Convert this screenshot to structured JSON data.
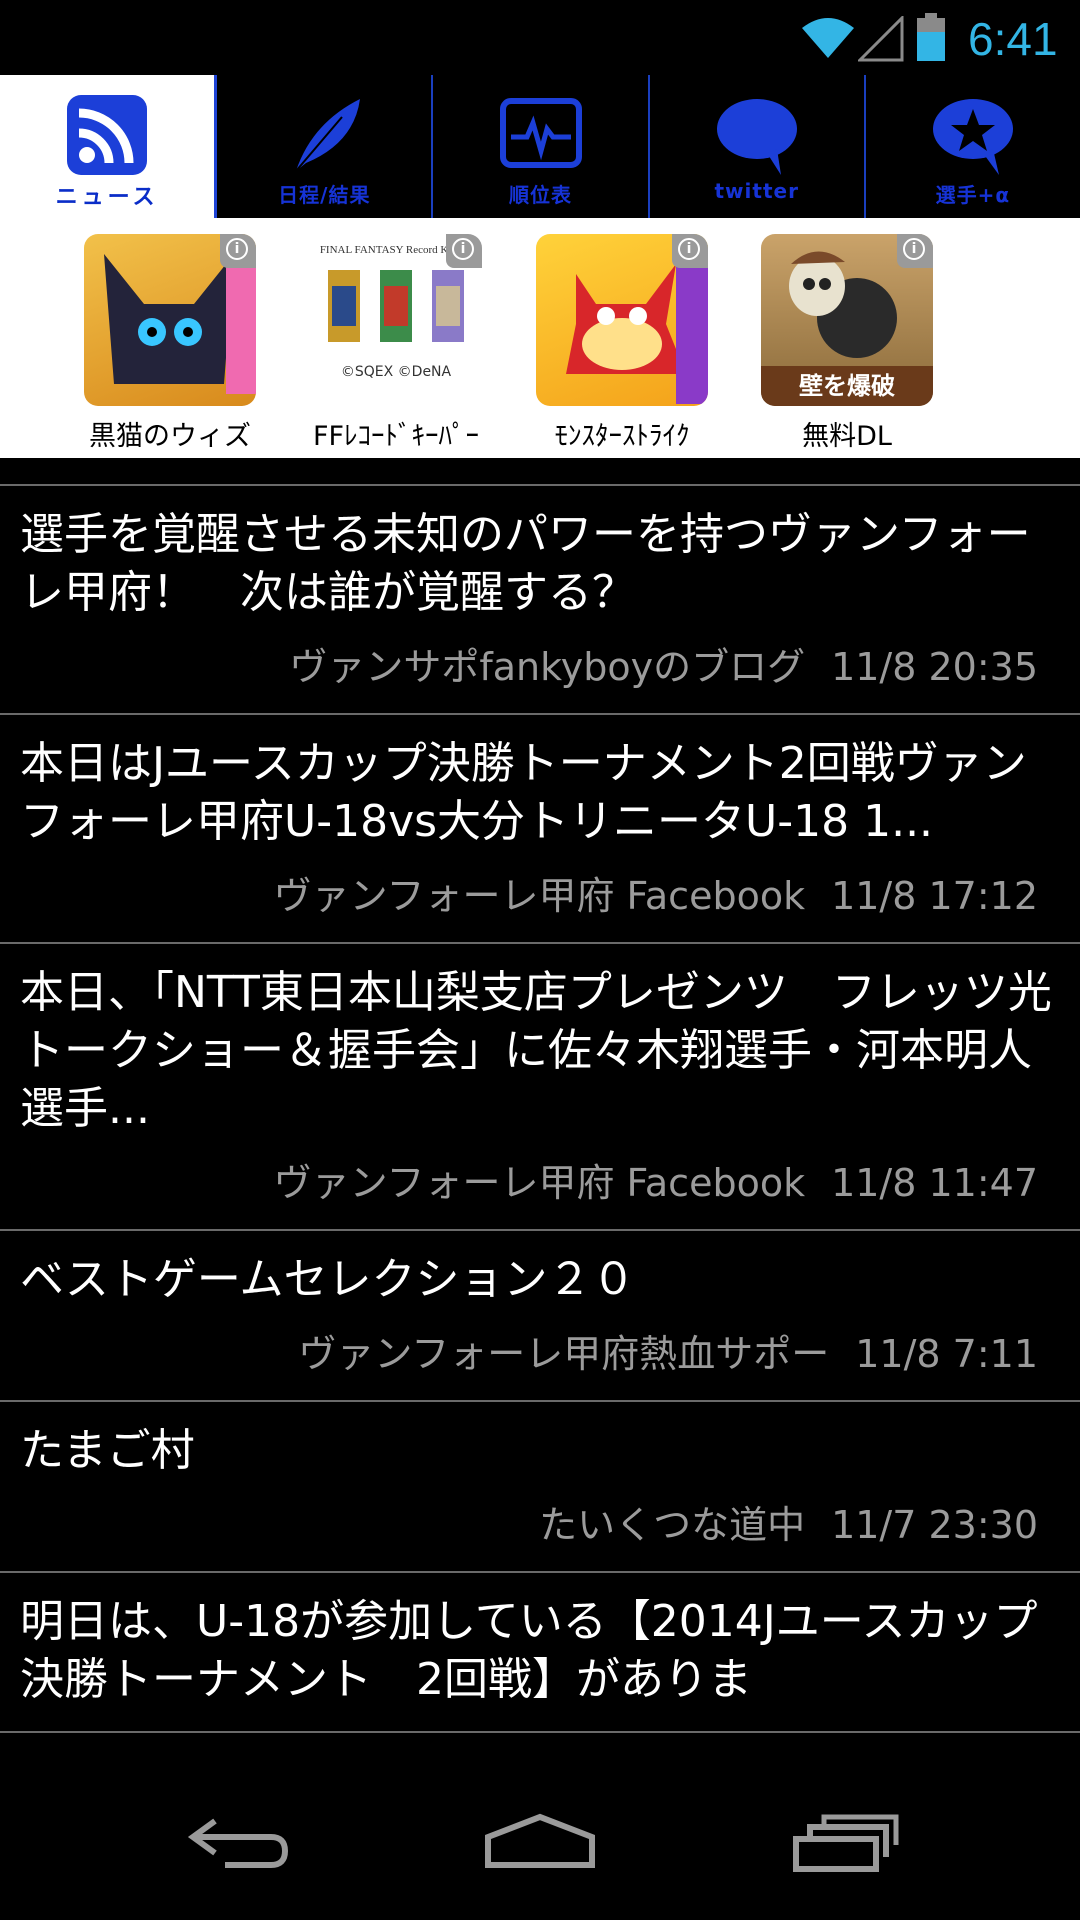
{
  "status_bar": {
    "time": "6:41",
    "icons": [
      "wifi-icon",
      "signal-icon",
      "battery-icon"
    ],
    "accent_color": "#33b5e5"
  },
  "tabs": [
    {
      "label": "ニュース",
      "icon": "rss-icon",
      "active": true
    },
    {
      "label": "日程/結果",
      "icon": "feather-icon",
      "active": false
    },
    {
      "label": "順位表",
      "icon": "pulse-monitor-icon",
      "active": false
    },
    {
      "label": "twitter",
      "icon": "speech-bubble-icon",
      "active": false
    },
    {
      "label": "選手+α",
      "icon": "star-bubble-icon",
      "active": false
    }
  ],
  "ads": [
    {
      "caption": "黒猫のウィズ",
      "icon": "black-cat-game-icon"
    },
    {
      "caption": "FFﾚｺｰﾄﾞｷｰﾊﾟｰ",
      "icon": "ff-record-keeper-icon",
      "logo_text": "FINAL FANTASY Record Keeper",
      "copyright": "©SQEX ©DeNA"
    },
    {
      "caption": "ﾓﾝｽﾀｰｽﾄﾗｲｸ",
      "icon": "monster-strike-icon"
    },
    {
      "caption": "無料DL",
      "icon": "bomb-skeleton-icon",
      "banner_text": "壁を爆破"
    }
  ],
  "feed": [
    {
      "title": "選手を覚醒させる未知のパワーを持つヴァンフォーレ甲府！　次は誰が覚醒する？",
      "source": "ヴァンサポfankyboyのブログ",
      "time": "11/8 20:35"
    },
    {
      "title": "本日はJユースカップ決勝トーナメント2回戦ヴァンフォーレ甲府U-18vs大分トリニータU-18 1...",
      "source": "ヴァンフォーレ甲府 Facebook",
      "time": "11/8 17:12"
    },
    {
      "title": "本日、「NTT東日本山梨支店プレゼンツ　フレッツ光トークショー＆握手会」に佐々木翔選手・河本明人選手...",
      "source": "ヴァンフォーレ甲府 Facebook",
      "time": "11/8 11:47"
    },
    {
      "title": "ベストゲームセレクション２０",
      "source": "ヴァンフォーレ甲府熱血サポー",
      "time": "11/8 7:11"
    },
    {
      "title": "たまご村",
      "source": "たいくつな道中",
      "time": "11/7 23:30"
    },
    {
      "title": "明日は、U-18が参加している【2014Jユースカップ 決勝トーナメント　2回戦】がありま",
      "source": "",
      "time": ""
    }
  ],
  "nav": {
    "buttons": [
      "back-icon",
      "home-icon",
      "recent-apps-icon"
    ]
  }
}
